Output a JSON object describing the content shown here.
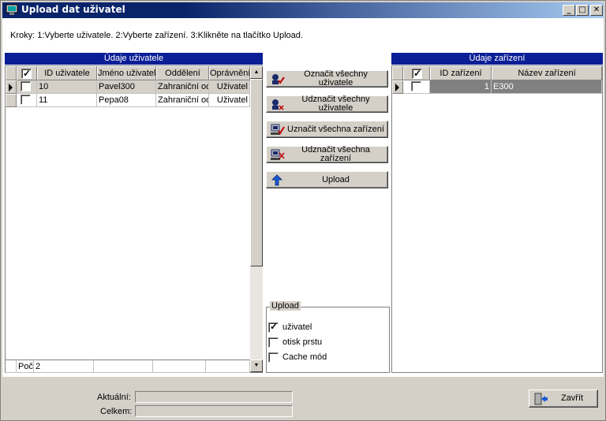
{
  "window": {
    "title": "Upload dat uživatel",
    "controls": [
      "_",
      "□",
      "✕"
    ]
  },
  "hint": "Kroky: 1:Vyberte uživatele. 2:Vyberte zařízení. 3:Klikněte na tlačítko Upload.",
  "users_panel": {
    "header": "Údaje uživatele",
    "columns": [
      "ID uživatele",
      "Jméno uživatele",
      "Oddělení",
      "Oprávnění"
    ],
    "header_checkbox_checked": true,
    "rows": [
      {
        "checked": false,
        "id": "10",
        "name": "Pavel300",
        "dept": "Zahraniční od",
        "role": "Uživatel"
      },
      {
        "checked": false,
        "id": "11",
        "name": "Pepa08",
        "dept": "Zahraniční od",
        "role": "Uživatel"
      }
    ],
    "footer_label": "Poč",
    "footer_count": "2"
  },
  "actions": {
    "select_all_users": "Označit všechny uživatele",
    "deselect_all_users": "Udznačit všechny uživatele",
    "select_all_devices": "Uznačit všechna zařízení",
    "deselect_all_devices": "Udznačit všechna zařízení",
    "upload": "Upload"
  },
  "upload_group": {
    "legend": "Upload",
    "options": [
      {
        "label": "uživatel",
        "checked": true
      },
      {
        "label": "otisk prstu",
        "checked": false
      },
      {
        "label": "Cache mód",
        "checked": false
      }
    ]
  },
  "devices_panel": {
    "header": "Údaje zařízení",
    "columns": [
      "ID zařízení",
      "Název zařízení"
    ],
    "header_checkbox_checked": true,
    "rows": [
      {
        "checked": false,
        "id": "1",
        "name": "E300"
      }
    ]
  },
  "status": {
    "current_label": "Aktuální:",
    "total_label": "Celkem:"
  },
  "close_button": "Zavřít",
  "colors": {
    "panel_header": "#0a1e96",
    "title_start": "#0a246a",
    "title_end": "#a6caf0",
    "selected_row": "#808080"
  }
}
